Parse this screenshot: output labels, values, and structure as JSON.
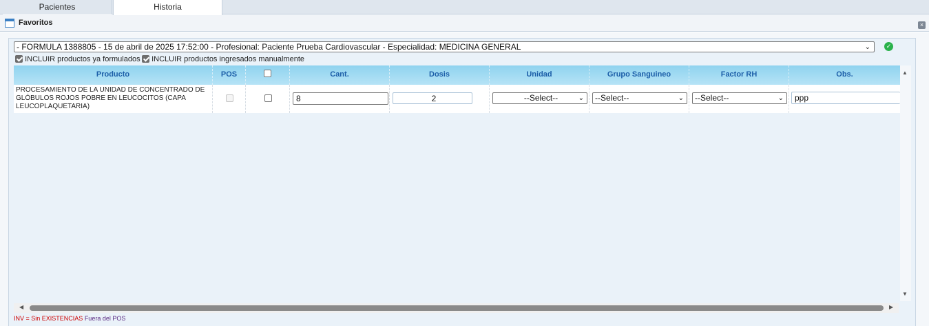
{
  "tabs": [
    {
      "label": "Pacientes",
      "active": false
    },
    {
      "label": "Historia",
      "active": true
    }
  ],
  "panel": {
    "title": "Favoritos",
    "close_icon": "close-icon"
  },
  "formula": {
    "selected": "- FORMULA 1388805 - 15 de abril de 2025 17:52:00 - Profesional: Paciente Prueba Cardiovascular - Especialidad: MEDICINA GENERAL",
    "confirm_icon": "check-circle-icon"
  },
  "options": {
    "incluir_formulados": {
      "label": "INCLUIR productos ya formulados",
      "checked": true
    },
    "incluir_manual": {
      "label": "INCLUIR productos ingresados manualmente",
      "checked": true
    }
  },
  "grid": {
    "headers": {
      "producto": "Producto",
      "pos": "POS",
      "cant": "Cant.",
      "dosis": "Dosis",
      "unidad": "Unidad",
      "grupo": "Grupo Sanguineo",
      "factor": "Factor RH",
      "obs": "Obs."
    },
    "rows": [
      {
        "producto": "PROCESAMIENTO DE LA UNIDAD DE CONCENTRADO DE GLÓBULOS ROJOS POBRE EN LEUCOCITOS (CAPA LEUCOPLAQUETARIA)",
        "cant": "8",
        "dosis": "2",
        "unidad": "--Select--",
        "grupo": "--Select--",
        "factor": "--Select--",
        "obs": "ppp"
      }
    ]
  },
  "legend": {
    "inv": "INV = Sin EXISTENCIAS",
    "pos": "Fuera del POS"
  }
}
